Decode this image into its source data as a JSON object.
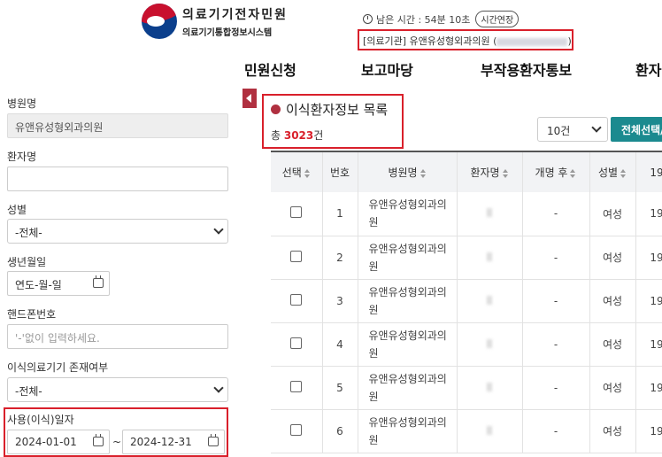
{
  "header": {
    "logo_title": "의료기기전자민원",
    "logo_subtitle": "의료기기통합정보시스템",
    "session_remaining": "남은 시간 : 54분 10초",
    "session_extend": "시간연장",
    "institution_prefix": "[의료기관] 유앤유성형외과의원 (",
    "institution_suffix": ")"
  },
  "nav": {
    "items": [
      "민원신청",
      "보고마당",
      "부작용환자통보",
      "환자"
    ]
  },
  "sidebar": {
    "hospital_label": "병원명",
    "hospital_value": "유앤유성형외과의원",
    "patient_label": "환자명",
    "gender_label": "성별",
    "gender_value": "-전체-",
    "birth_label": "생년월일",
    "birth_value": "연도-월-일",
    "phone_label": "핸드폰번호",
    "phone_placeholder": "'-'없이 입력하세요.",
    "implant_label": "이식의료기기 존재여부",
    "implant_value": "-전체-",
    "date_label": "사용(이식)일자",
    "date_from": "2024-01-01",
    "date_tilde": "~",
    "date_to": "2024-12-31"
  },
  "main": {
    "title": "이식환자정보 목록",
    "total_prefix": "총 ",
    "total_count": "3023",
    "total_suffix": "건",
    "page_size": "10건",
    "select_all_button": "전체선택/",
    "columns": [
      "선택",
      "번호",
      "병원명",
      "환자명",
      "개명 후",
      "성별",
      "19"
    ],
    "rows": [
      {
        "no": "1",
        "hospital": "유앤유성형외과의원",
        "rename": "-",
        "gender": "여성",
        "birth": "19"
      },
      {
        "no": "2",
        "hospital": "유앤유성형외과의원",
        "rename": "-",
        "gender": "여성",
        "birth": "19"
      },
      {
        "no": "3",
        "hospital": "유앤유성형외과의원",
        "rename": "-",
        "gender": "여성",
        "birth": "19"
      },
      {
        "no": "4",
        "hospital": "유앤유성형외과의원",
        "rename": "-",
        "gender": "여성",
        "birth": "19"
      },
      {
        "no": "5",
        "hospital": "유앤유성형외과의원",
        "rename": "-",
        "gender": "여성",
        "birth": "19"
      },
      {
        "no": "6",
        "hospital": "유앤유성형외과의원",
        "rename": "-",
        "gender": "여성",
        "birth": "19"
      }
    ]
  },
  "colors": {
    "accent": "#b03040",
    "highlight_border": "#d9202b",
    "button_teal": "#1b8a8f"
  }
}
